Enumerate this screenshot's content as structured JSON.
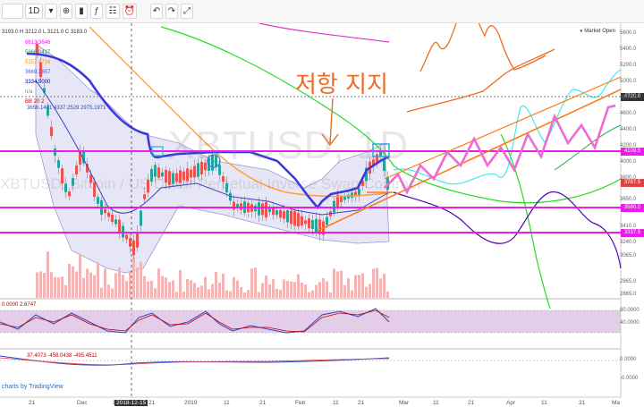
{
  "toolbar": {
    "symbol": "",
    "interval": "1D",
    "items": [
      "fx",
      "",
      "",
      "",
      "",
      "",
      "",
      ""
    ]
  },
  "chart": {
    "watermark": "XBTUSD, 1D",
    "ticker_desc": "XBTUSD: Bitcoin / US Dollar Perpetual Inverse Swap Contract",
    "ohlc": "3193.0 H 3212.0 L 3121.0 C 3183.0",
    "ma_values": [
      {
        "text": "6613.3646",
        "color": "#ff00ff"
      },
      {
        "text": "5866.0417",
        "color": "#1a9641"
      },
      {
        "text": "5157.4716",
        "color": "#ff8800"
      },
      {
        "text": "3669.2857",
        "color": "#4d4dff"
      },
      {
        "text": "3334.5000",
        "color": "#0000aa"
      },
      {
        "text": "n/a",
        "color": "#888888"
      },
      {
        "text": "BB 20 2",
        "color": "#c00000"
      }
    ],
    "bb_values": "3656.1471 4337.2529 2975.1971",
    "annotation_korean": "저항 지지",
    "market_open": "Market Open",
    "price_labels": [
      {
        "text": "4109.5",
        "color": "#e91ee6"
      },
      {
        "text": "3787.5",
        "color": "#e04040"
      },
      {
        "text": "3580.0",
        "color": "#e91ee6"
      },
      {
        "text": "3337.5",
        "color": "#e91ee6"
      },
      {
        "text": "4720.0",
        "color": "#333333"
      }
    ],
    "y_axis": [
      "5600.0",
      "5400.0",
      "5200.0",
      "5000.0",
      "4800.0",
      "4600.0",
      "4400.0",
      "4200.0",
      "4000.0",
      "3800.0",
      "3650.0",
      "3410.0",
      "3240.0",
      "3065.0",
      "2965.0",
      "2865.0"
    ],
    "x_axis": [
      "21",
      "Dec",
      "11",
      "2018-12-15",
      "21",
      "2019",
      "11",
      "21",
      "Feb",
      "11",
      "21",
      "Mar",
      "11",
      "21",
      "Apr",
      "11",
      "21",
      "Ma"
    ],
    "stoch": {
      "values": "0.0000  2.6747",
      "levels": [
        "80.0000",
        "40.0000"
      ]
    },
    "macd": {
      "values": "37.4073  -458.0438  -495.4511",
      "levels": [
        "0.0000",
        "-0.0000"
      ]
    },
    "branding": "charts by TradingView"
  },
  "colors": {
    "magenta_line": "#e91ee6",
    "blue_line": "#3a3adf",
    "orange_line": "#ff7a1a",
    "green_line": "#22dd22",
    "purple_line": "#5a00b0",
    "candle_up": "#26a69a",
    "candle_down": "#ef5350"
  }
}
